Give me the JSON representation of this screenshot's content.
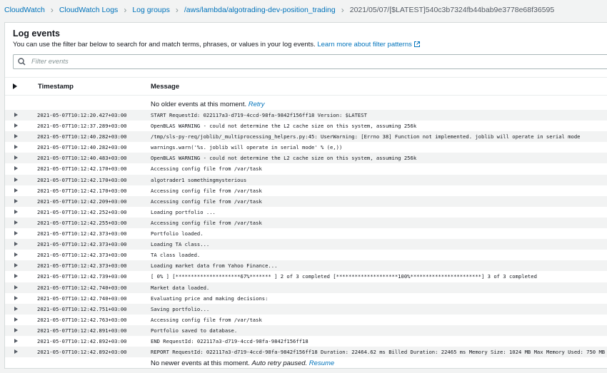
{
  "breadcrumb": [
    {
      "label": "CloudWatch"
    },
    {
      "label": "CloudWatch Logs"
    },
    {
      "label": "Log groups"
    },
    {
      "label": "/aws/lambda/algotrading-dev-position_trading"
    },
    {
      "label": "2021/05/07/[$LATEST]540c3b7324fb44bab9e3778e68f36595"
    }
  ],
  "panel": {
    "title": "Log events",
    "description": "You can use the filter bar below to search for and match terms, phrases, or values in your log events.",
    "learn_more": "Learn more about filter patterns",
    "filter_placeholder": "Filter events"
  },
  "table": {
    "col_timestamp": "Timestamp",
    "col_message": "Message"
  },
  "notices": {
    "older_text": "No older events at this moment.",
    "older_link": "Retry",
    "newer_text": "No newer events at this moment.",
    "newer_auto": "Auto retry paused.",
    "newer_link": "Resume"
  },
  "rows": [
    {
      "ts": "2021-05-07T10:12:20.427+03:00",
      "msg": "START RequestId: 022117a3-d719-4ccd-98fa-9842f156ff18 Version: $LATEST"
    },
    {
      "ts": "2021-05-07T10:12:37.289+03:00",
      "msg": "OpenBLAS WARNING - could not determine the L2 cache size on this system, assuming 256k"
    },
    {
      "ts": "2021-05-07T10:12:40.282+03:00",
      "msg": "/tmp/sls-py-req/joblib/_multiprocessing_helpers.py:45: UserWarning: [Errno 38] Function not implemented. joblib will operate in serial mode"
    },
    {
      "ts": "2021-05-07T10:12:40.282+03:00",
      "msg": "warnings.warn('%s. joblib will operate in serial mode' % (e,))"
    },
    {
      "ts": "2021-05-07T10:12:40.483+03:00",
      "msg": "OpenBLAS WARNING - could not determine the L2 cache size on this system, assuming 256k"
    },
    {
      "ts": "2021-05-07T10:12:42.170+03:00",
      "msg": "Accessing config file from /var/task"
    },
    {
      "ts": "2021-05-07T10:12:42.170+03:00",
      "msg": "algotrader1 somethingmysterious"
    },
    {
      "ts": "2021-05-07T10:12:42.170+03:00",
      "msg": "Accessing config file from /var/task"
    },
    {
      "ts": "2021-05-07T10:12:42.209+03:00",
      "msg": "Accessing config file from /var/task"
    },
    {
      "ts": "2021-05-07T10:12:42.252+03:00",
      "msg": "Loading portfolio ..."
    },
    {
      "ts": "2021-05-07T10:12:42.255+03:00",
      "msg": "Accessing config file from /var/task"
    },
    {
      "ts": "2021-05-07T10:12:42.373+03:00",
      "msg": "Portfolio loaded."
    },
    {
      "ts": "2021-05-07T10:12:42.373+03:00",
      "msg": "Loading TA class..."
    },
    {
      "ts": "2021-05-07T10:12:42.373+03:00",
      "msg": "TA class loaded."
    },
    {
      "ts": "2021-05-07T10:12:42.373+03:00",
      "msg": "Loading market data from Yahoo Finance..."
    },
    {
      "ts": "2021-05-07T10:12:42.739+03:00",
      "msg": "[ 0% ] [*********************67%******* ] 2 of 3 completed [********************100%***********************] 3 of 3 completed"
    },
    {
      "ts": "2021-05-07T10:12:42.740+03:00",
      "msg": "Market data loaded."
    },
    {
      "ts": "2021-05-07T10:12:42.740+03:00",
      "msg": "Evaluating price and making decisions:"
    },
    {
      "ts": "2021-05-07T10:12:42.751+03:00",
      "msg": "Saving portfolio..."
    },
    {
      "ts": "2021-05-07T10:12:42.763+03:00",
      "msg": "Accessing config file from /var/task"
    },
    {
      "ts": "2021-05-07T10:12:42.891+03:00",
      "msg": "Portfolio saved to database."
    },
    {
      "ts": "2021-05-07T10:12:42.892+03:00",
      "msg": "END RequestId: 022117a3-d719-4ccd-98fa-9842f156ff18"
    },
    {
      "ts": "2021-05-07T10:12:42.892+03:00",
      "msg": "REPORT RequestId: 022117a3-d719-4ccd-98fa-9842f156ff18 Duration: 22464.62 ms Billed Duration: 22465 ms Memory Size: 1024 MB Max Memory Used: 750 MB"
    }
  ],
  "colors": {
    "link": "#0073bb",
    "row_alt": "#f2f3f3",
    "border": "#d5dbdb"
  }
}
